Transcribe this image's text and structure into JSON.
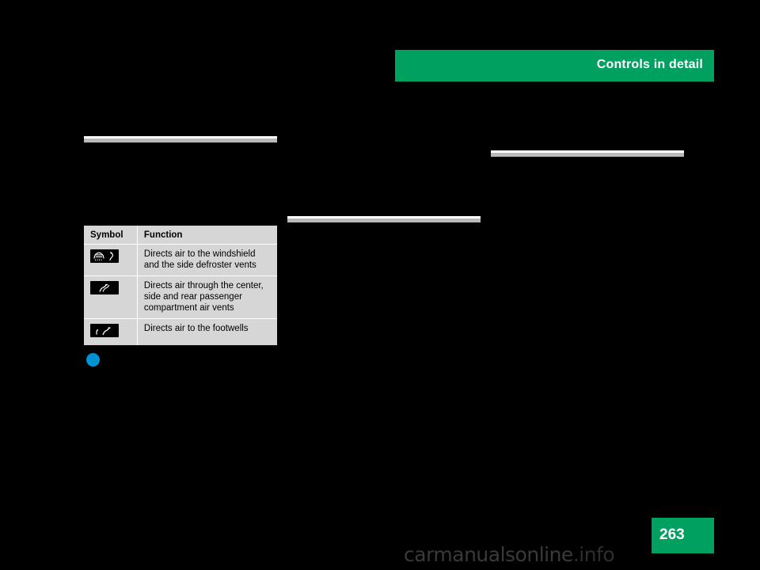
{
  "header": {
    "title": "Controls in detail",
    "bg_color": "#00a160",
    "text_color": "#ffffff"
  },
  "rules": {
    "left_label": "section-rule-left",
    "middle_label": "section-rule-middle",
    "right_label": "section-rule-right",
    "color": "#b9b9b9"
  },
  "symbol_table": {
    "headers": [
      "Symbol",
      "Function"
    ],
    "rows": [
      {
        "symbol_name": "windshield-defroster-icon",
        "function": "Directs air to the windshield and the side defroster vents"
      },
      {
        "symbol_name": "center-vents-icon",
        "function": "Directs air through the center, side and rear passenger compartment air vents"
      },
      {
        "symbol_name": "footwell-vents-icon",
        "function": "Directs air to the footwells"
      }
    ],
    "bg_color": "#d6d6d6"
  },
  "bullet": {
    "name": "blue-bullet-dot",
    "color": "#0093d3"
  },
  "page_marker": {
    "number": "263",
    "bg_color": "#00a160",
    "text_color": "#ffffff"
  },
  "watermark": {
    "text_main": "carmanualsonline",
    "text_suffix": ".info"
  }
}
